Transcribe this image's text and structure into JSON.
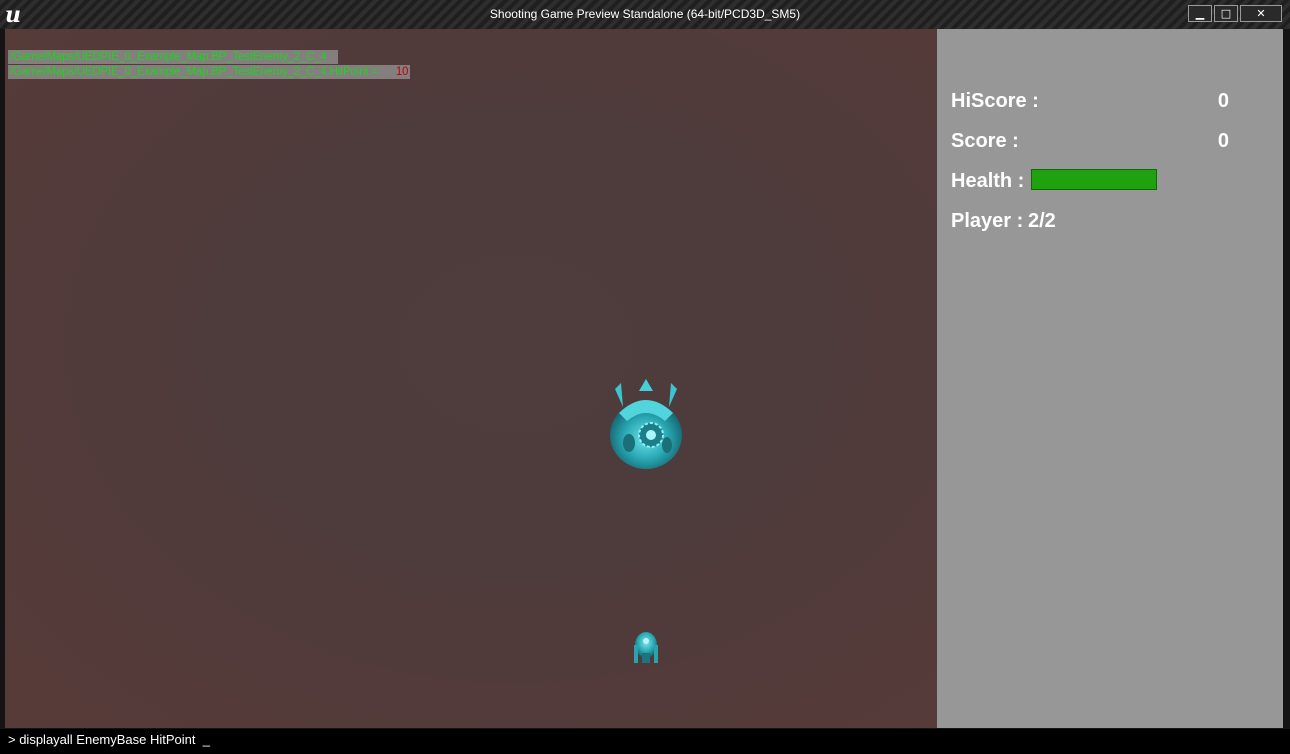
{
  "window": {
    "title": "Shooting Game Preview Standalone (64-bit/PCD3D_SM5)",
    "logo_text": "u",
    "buttons": {
      "minimize": "▁",
      "maximize": "□",
      "close": "✕"
    }
  },
  "viewport": {
    "debug_lines": [
      {
        "text": "/Game/Maps/UEDPIE_0_Example_Map.BP_TestEnemy_2_C_4",
        "value": ""
      },
      {
        "text": "/Game/Maps/UEDPIE_0_Example_Map.BP_TestEnemy_2_C_4.HitPoint =",
        "value": "10"
      }
    ],
    "colors": {
      "debug_text": "#1fd41f",
      "debug_value": "#c40000",
      "ship": "#2fb5bf"
    }
  },
  "hud": {
    "hiscore_label": "HiScore :",
    "hiscore_value": "0",
    "score_label": "Score :",
    "score_value": "0",
    "health_label": "Health :",
    "health_fraction": 1.0,
    "player_label": "Player :",
    "player_value": "2/2",
    "colors": {
      "health": "#20a10f",
      "panel": "#979797"
    }
  },
  "console": {
    "text": "> displayall EnemyBase HitPoint  _"
  }
}
